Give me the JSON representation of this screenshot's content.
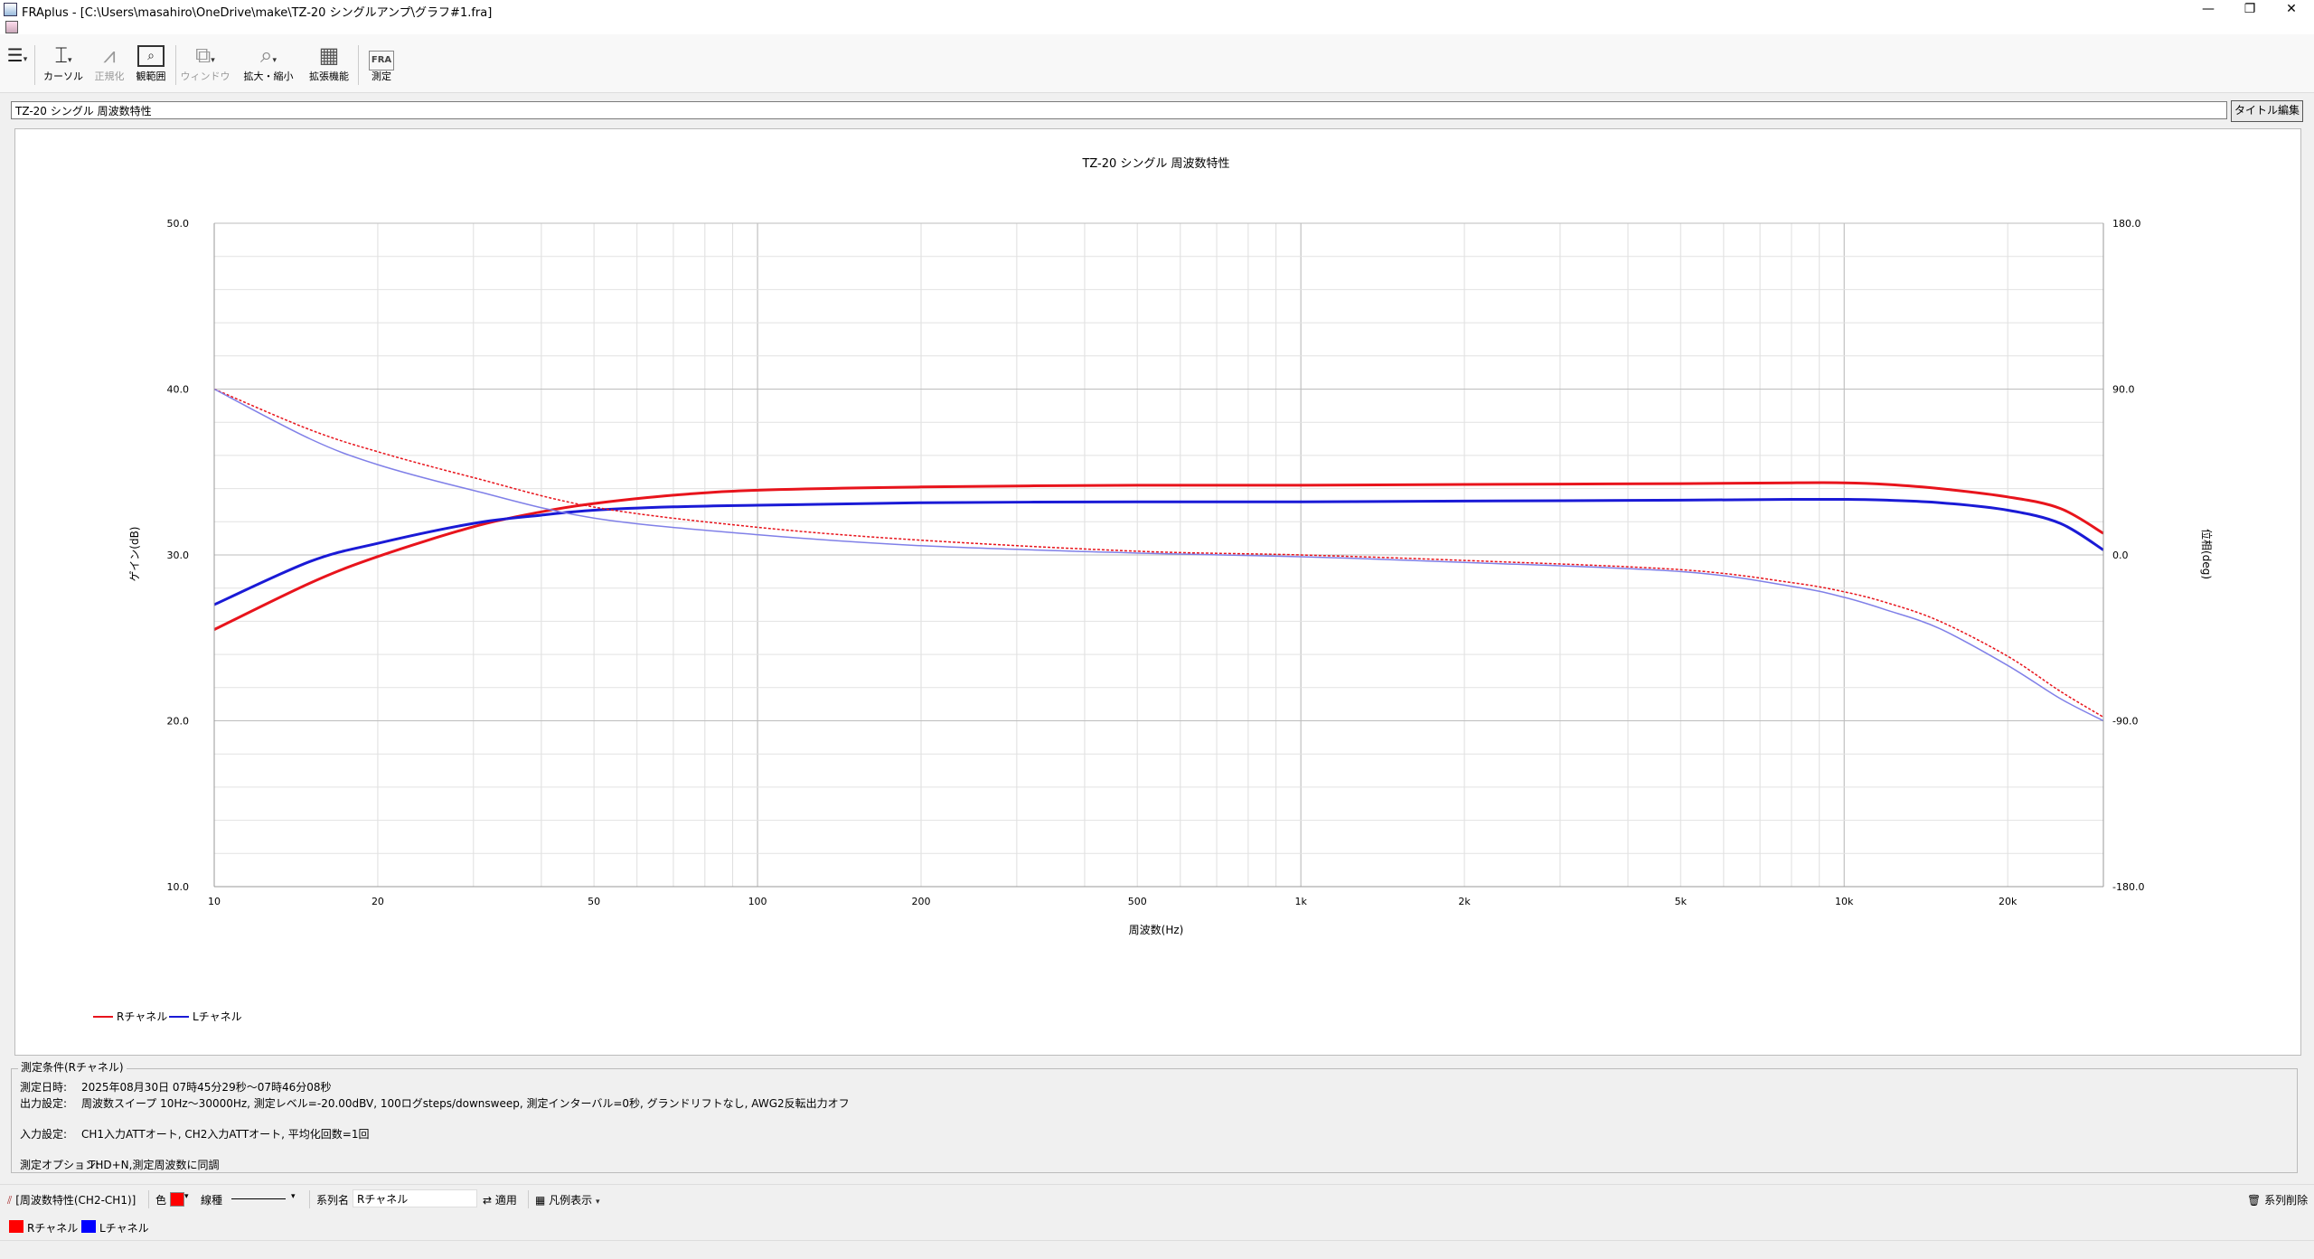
{
  "window": {
    "title": "FRAplus - [C:\\Users\\masahiro\\OneDrive\\make\\TZ-20 シングルアンプ\\グラフ#1.fra]",
    "minimize": "—",
    "restore": "❐",
    "close": "✕",
    "mdi_minimize": "–",
    "mdi_restore": "❐",
    "mdi_close": "×"
  },
  "toolbar": {
    "items": [
      {
        "label": "カーソル",
        "icon": "cursor-icon"
      },
      {
        "label": "正規化",
        "icon": "normalize-icon"
      },
      {
        "label": "観範囲",
        "icon": "range-icon"
      },
      {
        "label": "ウィンドウ",
        "icon": "window-icon"
      },
      {
        "label": "拡大・縮小",
        "icon": "zoom-icon"
      },
      {
        "label": "拡張機能",
        "icon": "grid-icon"
      },
      {
        "label": "測定",
        "icon": "fra-measure-icon"
      }
    ],
    "fra_icon_text": "FRA"
  },
  "title_field": {
    "value": "TZ-20 シングル 周波数特性",
    "edit_button": "タイトル編集"
  },
  "chart_data": {
    "type": "line",
    "title": "TZ-20 シングル 周波数特性",
    "xlabel": "周波数(Hz)",
    "ylabel": "ゲイン(dB)",
    "y2label": "位相(deg)",
    "xscale": "log",
    "xlim": [
      10,
      30000
    ],
    "ylim": [
      10,
      50
    ],
    "y2lim": [
      -180,
      180
    ],
    "grid": true,
    "legend_placement": "bottom-left",
    "x_ticks": [
      {
        "v": 10,
        "label": "10"
      },
      {
        "v": 20,
        "label": "20"
      },
      {
        "v": 50,
        "label": "50"
      },
      {
        "v": 100,
        "label": "100"
      },
      {
        "v": 200,
        "label": "200"
      },
      {
        "v": 500,
        "label": "500"
      },
      {
        "v": 1000,
        "label": "1k"
      },
      {
        "v": 2000,
        "label": "2k"
      },
      {
        "v": 5000,
        "label": "5k"
      },
      {
        "v": 10000,
        "label": "10k"
      },
      {
        "v": 20000,
        "label": "20k"
      }
    ],
    "y_ticks": [
      "10.0",
      "20.0",
      "30.0",
      "40.0",
      "50.0"
    ],
    "y2_ticks": [
      "-180.0",
      "-90.0",
      "0.0",
      "90.0",
      "180.0"
    ],
    "series": [
      {
        "name": "Rチャネル",
        "kind": "gain",
        "axis": "left",
        "color": "#e8141c",
        "x": [
          10,
          15,
          20,
          30,
          40,
          50,
          70,
          100,
          200,
          500,
          1000,
          2000,
          5000,
          8000,
          10000,
          12000,
          15000,
          20000,
          25000,
          30000
        ],
        "y": [
          25.5,
          28.3,
          29.9,
          31.7,
          32.6,
          33.1,
          33.6,
          33.9,
          34.1,
          34.2,
          34.2,
          34.25,
          34.3,
          34.35,
          34.35,
          34.25,
          34.0,
          33.5,
          32.8,
          31.3
        ]
      },
      {
        "name": "Lチャネル",
        "kind": "gain",
        "axis": "left",
        "color": "#1a1ad6",
        "x": [
          10,
          15,
          20,
          30,
          40,
          50,
          70,
          100,
          200,
          500,
          1000,
          2000,
          5000,
          8000,
          10000,
          12000,
          15000,
          20000,
          25000,
          30000
        ],
        "y": [
          27.0,
          29.6,
          30.7,
          31.9,
          32.4,
          32.7,
          32.9,
          33.0,
          33.15,
          33.2,
          33.2,
          33.25,
          33.3,
          33.35,
          33.35,
          33.3,
          33.15,
          32.7,
          31.9,
          30.3
        ]
      },
      {
        "name": "Rチャネル",
        "kind": "phase",
        "axis": "right",
        "color": "#e8141c",
        "x": [
          10,
          15,
          20,
          30,
          50,
          100,
          200,
          500,
          1000,
          2000,
          5000,
          8000,
          10000,
          12000,
          15000,
          20000,
          25000,
          30000
        ],
        "y": [
          90,
          68,
          56,
          42,
          26,
          15,
          8,
          2,
          0,
          -3,
          -8,
          -15,
          -20,
          -26,
          -36,
          -55,
          -74,
          -88
        ]
      },
      {
        "name": "Lチャネル",
        "kind": "phase",
        "axis": "right",
        "color": "#8080e8",
        "x": [
          10,
          15,
          20,
          30,
          50,
          100,
          200,
          500,
          1000,
          2000,
          5000,
          8000,
          10000,
          12000,
          15000,
          20000,
          25000,
          30000
        ],
        "y": [
          90,
          63,
          49,
          35,
          20,
          11,
          5,
          1,
          -1,
          -4,
          -9,
          -17,
          -23,
          -30,
          -40,
          -60,
          -78,
          -90
        ]
      }
    ],
    "legend": [
      {
        "name": "Rチャネル",
        "color": "#e8141c"
      },
      {
        "name": "Lチャネル",
        "color": "#1a1ad6"
      }
    ]
  },
  "conditions": {
    "title": "測定条件(Rチャネル)",
    "lines": [
      {
        "label": "測定日時:",
        "value": "2025年08月30日 07時45分29秒〜07時46分08秒"
      },
      {
        "label": "出力設定:",
        "value": "周波数スイープ 10Hz〜30000Hz, 測定レベル=-20.00dBV, 100ログsteps/downsweep, 測定インターバル=0秒, グランドリフトなし, AWG2反転出力オフ"
      },
      {
        "label": "入力設定:",
        "value": "CH1入力ATTオート, CH2入力ATTオート, 平均化回数=1回"
      },
      {
        "label": "測定オプション:",
        "value": "THD+N,測定周波数に同調"
      }
    ]
  },
  "bottom_bar": {
    "graph_label": "[周波数特性(CH2-CH1)]",
    "color_label": "色",
    "color_value": "#ff0000",
    "linetype_label": "線種",
    "series_name_label": "系列名",
    "series_name_value": "Rチャネル",
    "apply_label": "適用",
    "legend_label": "凡例表示",
    "delete_label": "系列削除"
  },
  "series_chips": [
    {
      "name": "Rチャネル",
      "color": "#ff0000"
    },
    {
      "name": "Lチャネル",
      "color": "#0000ff"
    }
  ]
}
